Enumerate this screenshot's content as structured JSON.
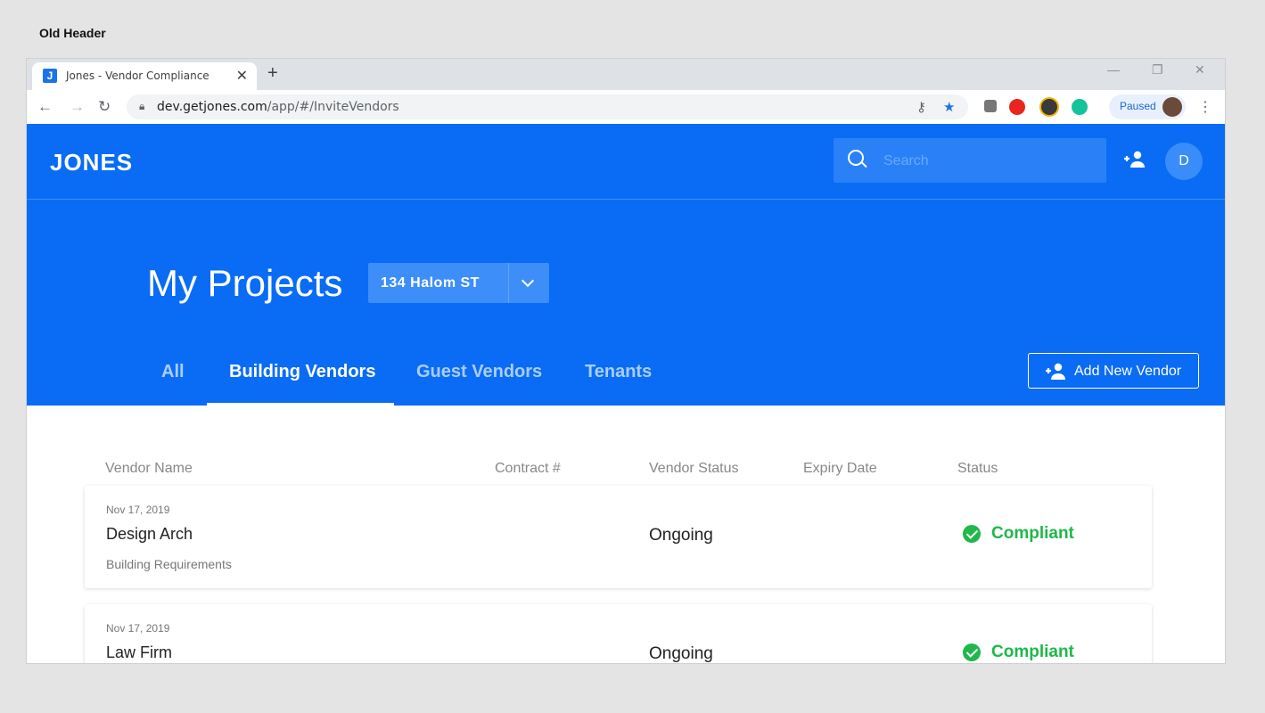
{
  "caption": "Old Header",
  "browser": {
    "tab_title": "Jones - Vendor Compliance",
    "favicon_letter": "J",
    "url_host": "dev.getjones.com",
    "url_path": "/app/#/InviteVendors",
    "profile_label": "Paused"
  },
  "header": {
    "logo": "JONES",
    "search_placeholder": "Search",
    "avatar_initial": "D"
  },
  "hero": {
    "title": "My Projects",
    "project": "134 Halom ST",
    "tabs": [
      {
        "label": "All"
      },
      {
        "label": "Building Vendors"
      },
      {
        "label": "Guest Vendors"
      },
      {
        "label": "Tenants"
      }
    ],
    "add_vendor_label": "Add New Vendor"
  },
  "table": {
    "columns": [
      "Vendor Name",
      "Contract #",
      "Vendor Status",
      "Expiry Date",
      "Status"
    ],
    "rows": [
      {
        "date": "Nov 17, 2019",
        "name": "Design Arch",
        "type": "Building Requirements",
        "vendor_status": "Ongoing",
        "status": "Compliant"
      },
      {
        "date": "Nov 17, 2019",
        "name": "Law Firm",
        "type": "",
        "vendor_status": "Ongoing",
        "status": "Compliant"
      }
    ]
  },
  "colors": {
    "brand": "#0a6cf5",
    "compliant": "#1fb84a"
  }
}
